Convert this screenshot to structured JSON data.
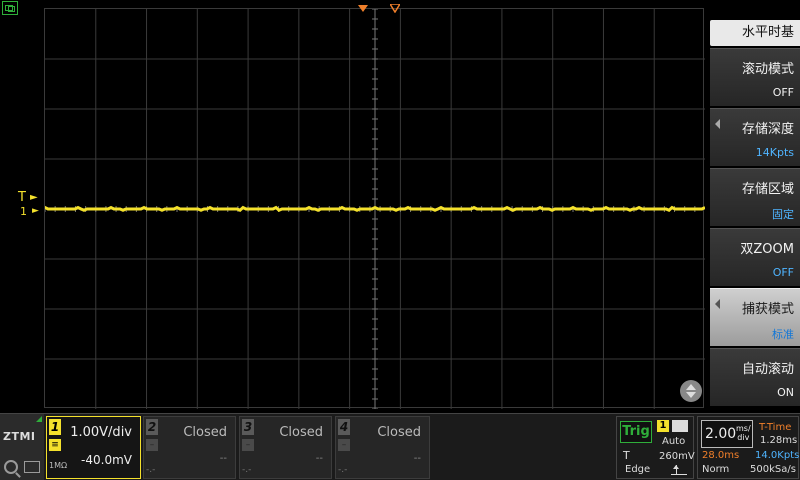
{
  "colors": {
    "ch1": "#f4e12c",
    "trigger": "#f07f2a",
    "accent": "#2fae3a",
    "value_blue": "#4fb4ff",
    "grid": "#3a3a3a"
  },
  "display": {
    "trigger_level_label": "T",
    "ch1_ref_label": "1",
    "ch1_trace_level": 0
  },
  "menu": {
    "title": "水平时基",
    "items": [
      {
        "label": "滚动模式",
        "value": "OFF"
      },
      {
        "label": "存储深度",
        "value": "14Kpts"
      },
      {
        "label": "存储区域",
        "value": "固定"
      },
      {
        "label": "双ZOOM",
        "value": "OFF"
      },
      {
        "label": "捕获模式",
        "value": "标准"
      },
      {
        "label": "自动滚动",
        "value": "ON"
      }
    ]
  },
  "bottom": {
    "logo": "ZTMI",
    "ch1": {
      "number": "1",
      "scale": "1.00V/div",
      "offset": "-40.0mV",
      "coupling": "1MΩ"
    },
    "ch2": {
      "number": "2",
      "status": "Closed",
      "offset": "--",
      "dash": "-.-"
    },
    "ch3": {
      "number": "3",
      "status": "Closed",
      "offset": "--",
      "dash": "-.-"
    },
    "ch4": {
      "number": "4",
      "status": "Closed",
      "offset": "--",
      "dash": "-.-"
    },
    "trigger": {
      "label": "Trig",
      "source": "1",
      "mode": "Auto",
      "type_short": "T",
      "level": "260mV",
      "type": "Edge"
    },
    "timebase": {
      "value": "2.00",
      "unit_top": "ms/",
      "unit_bottom": "div",
      "t_time_label": "T-Time",
      "t_time_value": "1.28ms",
      "delay": "28.0ms",
      "depth": "14.0Kpts",
      "acq_mode": "Norm",
      "sample_rate": "500kSa/s"
    }
  }
}
